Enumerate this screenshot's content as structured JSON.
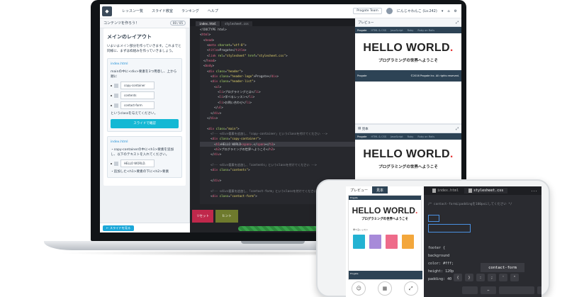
{
  "laptop": {
    "topnav": {
      "links": [
        "レッスン一覧",
        "スライド教室",
        "ランキング",
        "ヘルプ"
      ],
      "team": "Progate Team",
      "user": "にんじゃわんこ (Lv.242)"
    },
    "sidebar": {
      "header": "コンテンツを作ろう！",
      "header_pill": "00 / 05",
      "title": "メインのレイアウト",
      "intro": "いよいよメイン部分を作っていきます。これまでと同様に、まずは枠組みを作っていきましょう。",
      "task1": {
        "file": "index.html",
        "text": "mainの中に<div>要素を3つ用意し、上から順に",
        "classes": [
          "copy-container",
          "contents",
          "contact-form"
        ],
        "after": "というclassを与えてください。",
        "button": "スライドで確認"
      },
      "task2": {
        "file": "index.html",
        "text1": "・copy-containerの中に<h1>要素を追加し、以下のテキストを入れてください。",
        "value": "HELLO WORLD.",
        "text2": "・追加した<h1>要素の下に<h2>要素"
      },
      "footer_button": "← スライドを見る"
    },
    "editor": {
      "tabs": [
        "index.html",
        "stylesheet.css"
      ],
      "reset": "リセット",
      "hint": "ヒント",
      "progress": 0.88
    },
    "preview": {
      "header": "プレビュー",
      "nav_brand": "Progate",
      "nav_items": [
        "HTML & CSS",
        "JavaScript",
        "Ruby",
        "Ruby on Rails"
      ],
      "hello": "HELLO WORLD",
      "dot": ".",
      "subtitle": "プログラミングの世界へようこそ",
      "footer_brand": "Progate",
      "footer_right": "©2016 Progate Inc. All rights reserved."
    },
    "example": {
      "header": "見本",
      "nav_brand": "Progate",
      "nav_items": [
        "HTML & CSS",
        "JavaScript",
        "Ruby",
        "Ruby on Rails"
      ],
      "hello": "HELLO WORLD",
      "dot": ".",
      "subtitle": "プログラミングの世界へようこそ"
    }
  },
  "phone": {
    "tabs": [
      "プレビュー",
      "見本"
    ],
    "mini_nav": "Progate",
    "hello": "HELLO WORLD",
    "dot": ".",
    "subtitle": "プログラミングの世界へようこそ",
    "tag": "学べるレッスン",
    "tile_colors": [
      "#23b2d2",
      "#a78ad9",
      "#ee6b8a",
      "#f3a73c"
    ],
    "footer": "Progate",
    "code_tabs": [
      "index.html",
      "stylesheet.css"
    ],
    "more": "...",
    "comment": "/* contact-formにpaddingを100pxにしてください */",
    "code_lines": [
      {
        "k": "footer {",
        "p": ""
      },
      {
        "k": "background",
        "p": ""
      },
      {
        "k": "color: #fff;",
        "p": ""
      },
      {
        "k": "height: 120p",
        "p": ""
      },
      {
        "k": "padding: 40",
        "p": ""
      }
    ],
    "autocomplete": "contact-form",
    "keys": [
      "{",
      "}",
      ":",
      ";",
      "'",
      "\""
    ],
    "arrows": [
      "←",
      "→"
    ]
  }
}
